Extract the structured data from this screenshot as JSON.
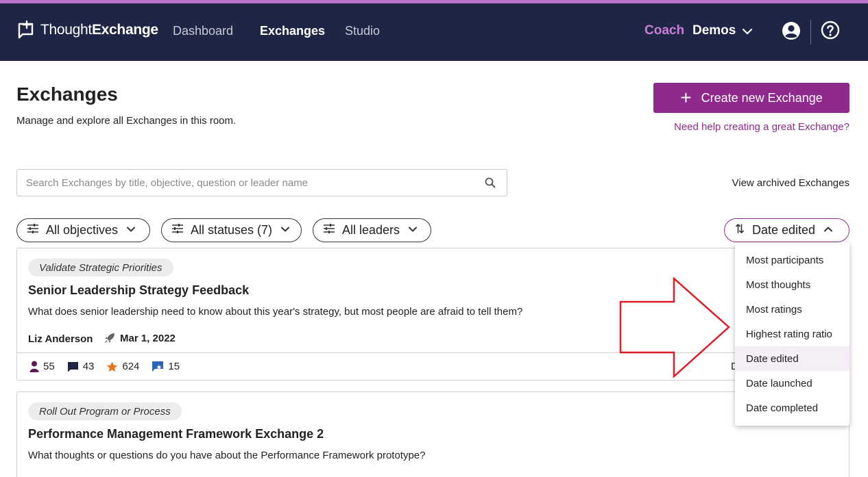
{
  "app": {
    "logo_light": "Thought",
    "logo_bold": "Exchange",
    "nav": [
      "Dashboard",
      "Exchanges",
      "Studio"
    ],
    "active_nav": "Exchanges",
    "coach_label": "Coach",
    "room_label": "Demos",
    "icons": [
      "logo-icon",
      "chevron-down-icon",
      "user-icon",
      "help-icon"
    ],
    "colors": {
      "navbar": "#1f2544",
      "accent": "#8e2a8b",
      "coach": "#c97fd9",
      "stripe": "#b873c8"
    }
  },
  "header": {
    "title": "Exchanges",
    "subtitle": "Manage and explore all Exchanges in this room.",
    "create_button": "Create new Exchange",
    "help_link": "Need help creating a great Exchange?"
  },
  "search": {
    "placeholder": "Search Exchanges by title, objective, question or leader name",
    "value": ""
  },
  "archived_link": "View archived Exchanges",
  "filters": {
    "objectives": "All objectives",
    "statuses": "All statuses (7)",
    "leaders": "All leaders"
  },
  "sort": {
    "current": "Date edited",
    "options": [
      "Most participants",
      "Most thoughts",
      "Most ratings",
      "Highest rating ratio",
      "Date edited",
      "Date launched",
      "Date completed"
    ]
  },
  "exchanges": [
    {
      "tag": "Validate Strategic Priorities",
      "title": "Senior Leadership Strategy Feedback",
      "question": "What does senior leadership need to know about this year's strategy, but most people are afraid to tell them?",
      "leader": "Liz Anderson",
      "launched": "Mar 1, 2022",
      "participants": "55",
      "thoughts": "43",
      "ratings": "624",
      "stars": "15",
      "trailing": "D"
    },
    {
      "tag": "Roll Out Program or Process",
      "title": "Performance Management Framework Exchange 2",
      "question": "What thoughts or questions do you have about the Performance Framework prototype?"
    }
  ]
}
